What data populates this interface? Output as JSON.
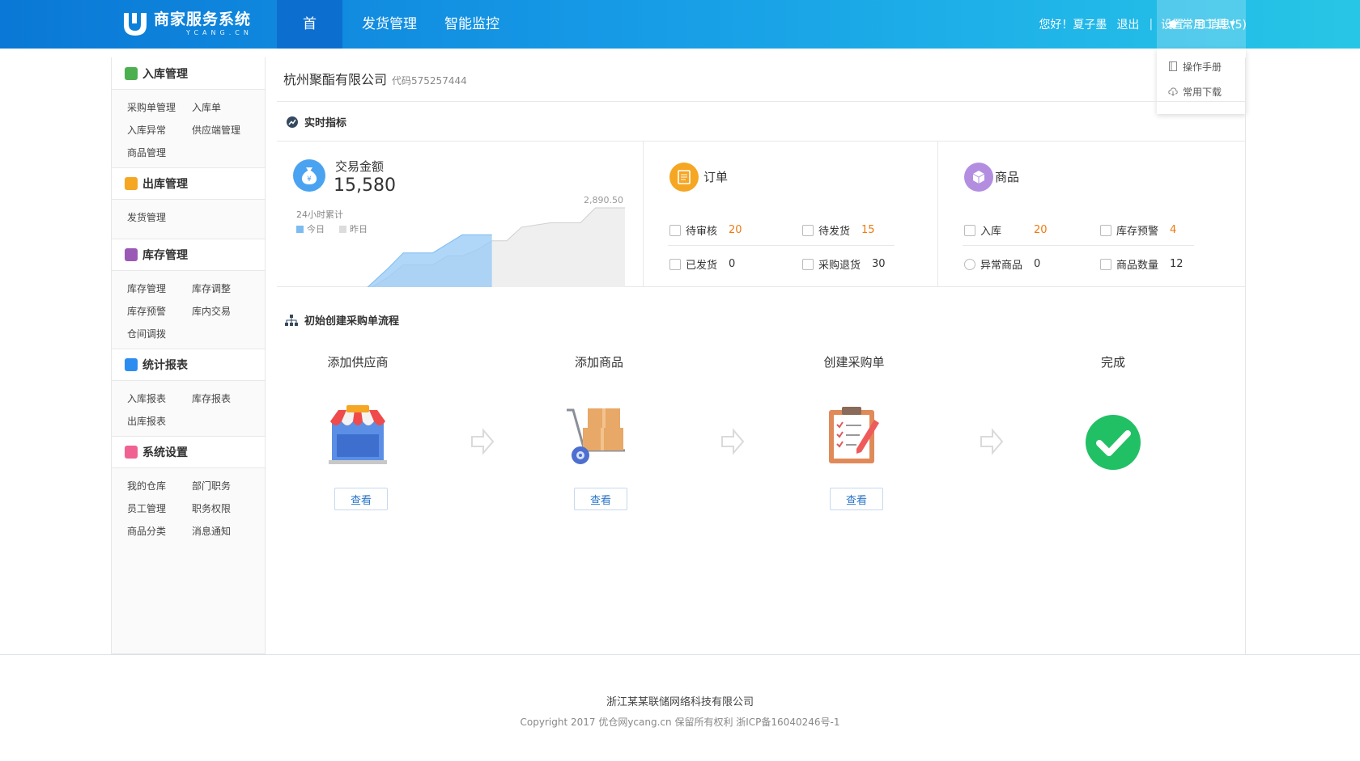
{
  "header": {
    "logo_title": "商家服务系统",
    "logo_sub": "YCANG.CN",
    "nav": [
      "首页",
      "发货管理",
      "智能监控"
    ],
    "greeting": "您好！夏子墨",
    "logout": "退出",
    "settings": "设置",
    "messages": "消息(5)",
    "tools": "常用工具",
    "tools_menu": [
      "操作手册",
      "常用下载"
    ]
  },
  "sidebar": [
    {
      "title": "入库管理",
      "color": "#4caf50",
      "items": [
        "采购单管理",
        "入库单",
        "入库异常",
        "供应端管理",
        "商品管理"
      ]
    },
    {
      "title": "出库管理",
      "color": "#f5a623",
      "items": [
        "发货管理"
      ]
    },
    {
      "title": "库存管理",
      "color": "#9b59b6",
      "items": [
        "库存管理",
        "库存调整",
        "库存预警",
        "库内交易",
        "仓间调拨"
      ]
    },
    {
      "title": "统计报表",
      "color": "#2d8cf0",
      "items": [
        "入库报表",
        "库存报表",
        "出库报表"
      ]
    },
    {
      "title": "系统设置",
      "color": "#f06292",
      "items": [
        "我的仓库",
        "部门职务",
        "员工管理",
        "职务权限",
        "商品分类",
        "消息通知"
      ]
    }
  ],
  "main": {
    "company": "杭州聚酯有限公司",
    "company_code": "代码575257444",
    "realtime_title": "实时指标",
    "flow_title": "初始创建采购单流程"
  },
  "trade": {
    "label": "交易金额",
    "amount": "15,580",
    "sub": "24小时累计",
    "legend_today": "今日",
    "legend_yesterday": "昨日"
  },
  "orders": {
    "label": "订单",
    "stats": [
      {
        "label": "待审核",
        "value": "20",
        "orange": true
      },
      {
        "label": "待发货",
        "value": "15",
        "orange": true
      },
      {
        "label": "已发货",
        "value": "0",
        "orange": false
      },
      {
        "label": "采购退货",
        "value": "30",
        "orange": false
      }
    ]
  },
  "goods": {
    "label": "商品",
    "stats": [
      {
        "label": "入库",
        "value": "20",
        "orange": true
      },
      {
        "label": "库存预警",
        "value": "4",
        "orange": true
      },
      {
        "label": "异常商品",
        "value": "0",
        "orange": false
      },
      {
        "label": "商品数量",
        "value": "12",
        "orange": false
      }
    ]
  },
  "chart_data": {
    "type": "area",
    "x_ticks": [
      "0",
      "6",
      "12",
      "18",
      "23"
    ],
    "x": [
      0,
      3,
      5,
      7,
      8,
      10,
      11,
      12,
      13,
      14,
      15,
      16,
      18,
      20,
      21,
      23
    ],
    "series": [
      {
        "name": "今日",
        "color": "#a9d4f7",
        "values": [
          0,
          0,
          0,
          900,
          1400,
          1400,
          1700,
          2000,
          2000,
          2000
        ]
      },
      {
        "name": "昨日",
        "color": "#e3e3e3",
        "values": [
          0,
          0,
          0,
          600,
          1000,
          1000,
          1300,
          1300,
          1500,
          1800,
          1800,
          2250,
          2400,
          2400,
          2890.5,
          2890.5
        ]
      }
    ],
    "max_label": "2,890.50",
    "ylim": [
      0,
      2890.5
    ]
  },
  "flow": {
    "steps": [
      "添加供应商",
      "添加商品",
      "创建采购单",
      "完成"
    ],
    "view_label": "查看"
  },
  "footer": {
    "company": "浙江某某联储网络科技有限公司",
    "copyright": "Copyright   2017 优仓网ycang.cn 保留所有权利 浙ICP备16040246号-1"
  }
}
